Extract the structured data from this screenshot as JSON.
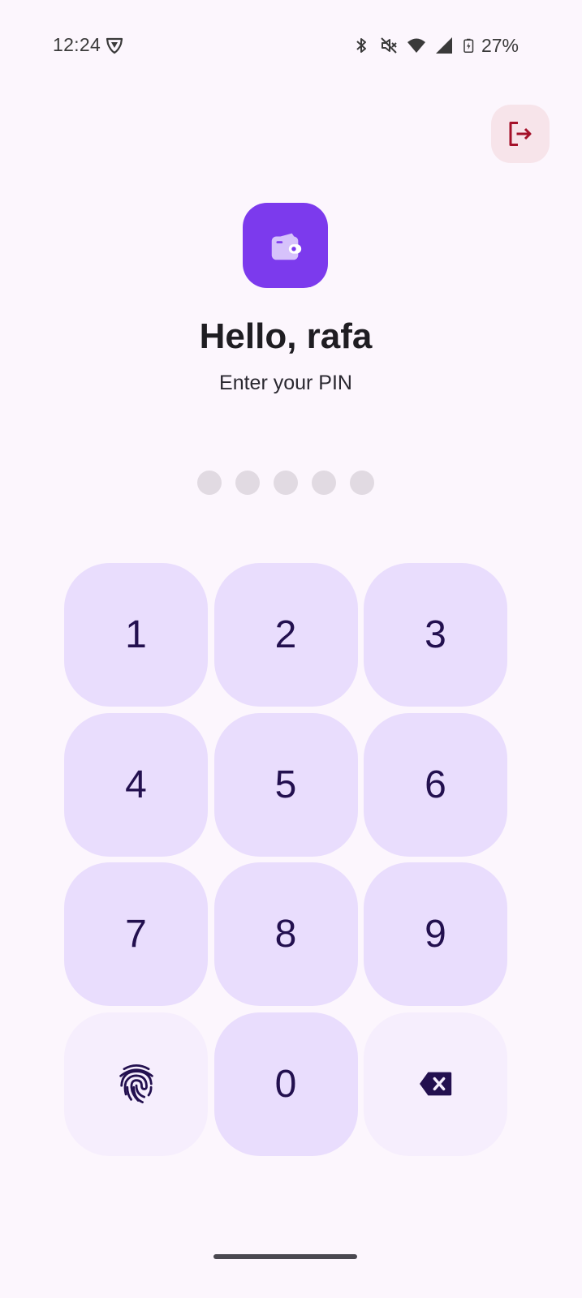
{
  "status_bar": {
    "time": "12:24",
    "battery_percent": "27%",
    "icons": [
      "vpn-shield-icon",
      "bluetooth-icon",
      "mute-icon",
      "wifi-icon",
      "cell-signal-icon",
      "battery-charging-icon"
    ]
  },
  "header": {
    "logout_icon": "logout-icon",
    "logout_color": "#A4112A"
  },
  "app": {
    "logo_icon": "wallet-icon",
    "accent_color": "#7C3AED"
  },
  "greeting": {
    "title": "Hello, rafa",
    "subtitle": "Enter your PIN"
  },
  "pin": {
    "length": 5,
    "entered": 0
  },
  "keypad": {
    "keys": [
      "1",
      "2",
      "3",
      "4",
      "5",
      "6",
      "7",
      "8",
      "9"
    ],
    "zero": "0",
    "fingerprint_icon": "fingerprint-icon",
    "backspace_icon": "backspace-icon"
  }
}
